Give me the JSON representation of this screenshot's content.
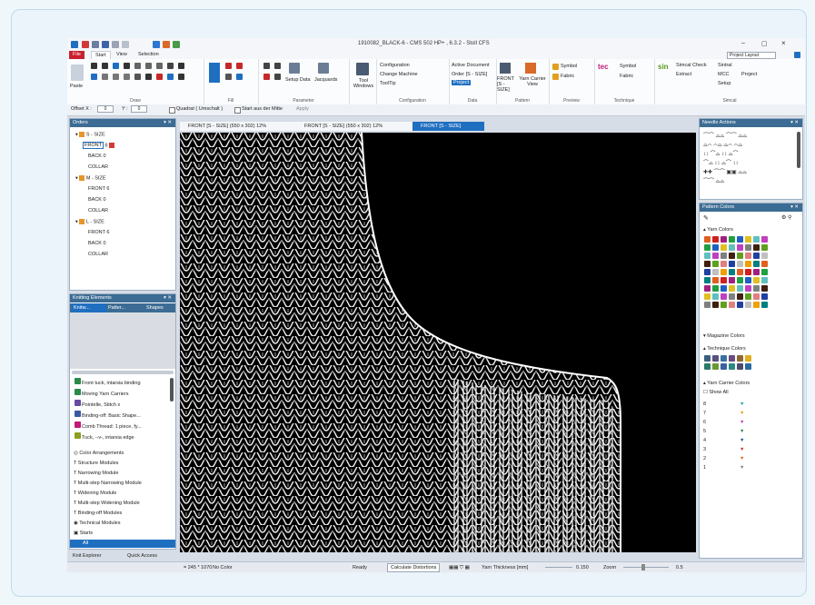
{
  "window": {
    "title": "1910082_BLACK-6 - CMS 502 HP+ , 6.3.2 - Stoll CFS",
    "project_layout": "Project Layout"
  },
  "menu": [
    "File",
    "Start",
    "View",
    "Selection"
  ],
  "ribbon": {
    "groups": [
      "Draw",
      "Fill",
      "Parameter",
      "Configuration",
      "Data",
      "Pattern",
      "Preview",
      "Technique",
      "Simcal"
    ],
    "paste": "Paste",
    "setup_data": "Setup Data",
    "jacquards": "Jacquards",
    "tool_windows": "Tool Windows",
    "configuration": "Configuration",
    "change_machine": "Change Machine",
    "tooltip": "ToolTip",
    "active_document": "Active Document",
    "order": "Order [S - SIZE]",
    "project": "Project",
    "front_size": "FRONT [S - SIZE]",
    "yarn_carrier_view": "Yarn Carrier View",
    "symbol": "Symbol",
    "fabric": "Fabric",
    "tec_symbol": "Symbol",
    "tec_fabric": "Fabric",
    "simcal_check": "Simcal Check",
    "extract": "Extract",
    "simcal": "Simcal",
    "sintral": "Sintral",
    "mcc": "MCC",
    "setup": "Setup",
    "project2": "Project"
  },
  "toolbar2": {
    "offset_x_label": "Offset X :",
    "offset_x": "0",
    "offset_y_label": "Y :",
    "offset_y": "0",
    "square": "Quadrat ( Umschalt )",
    "start_center": "Start aus der Mitte",
    "apply": "Apply"
  },
  "orders": {
    "title": "Orders",
    "items": [
      {
        "size": "S - SIZE",
        "parts": [
          "FRONT",
          "BACK",
          "COLLAR"
        ]
      },
      {
        "size": "M - SIZE",
        "parts": [
          "FRONT",
          "BACK",
          "COLLAR"
        ]
      },
      {
        "size": "L - SIZE",
        "parts": [
          "FRONT",
          "BACK",
          "COLLAR"
        ]
      }
    ],
    "count_front": "6",
    "count_back": "0"
  },
  "knitting_elements": {
    "title": "Knitting Elements",
    "tabs": [
      "Knitw...",
      "Patter...",
      "Shapes"
    ],
    "list": [
      "Front tuck, intarsia binding",
      "Moving Yarn Carriers",
      "Pointelle, Stitch x",
      "Binding-off: Basic Shape...",
      "Comb Thread: 1 piece, fy...",
      "Tuck, --v-, intarsia edge"
    ],
    "modules": [
      "Color Arrangements",
      "Structure Modules",
      "Narrowing Module",
      "Multi-step Narrowing Module",
      "Widening Module",
      "Multi-step Widening Module",
      "Binding-off Modules",
      "Technical Modules",
      "Starts"
    ],
    "all": "All"
  },
  "bottom_left": {
    "knit_explorer": "Knit Explorer",
    "quick_access": "Quick Access"
  },
  "doc_tabs": [
    "FRONT [S - SIZE] (550 x 302) 12%",
    "FRONT [S - SIZE] (550 x 302) 12%",
    "FRONT [S - SIZE]"
  ],
  "needle_actions": {
    "title": "Needle Actions"
  },
  "pattern_colors": {
    "title": "Pattern Colors",
    "sections": [
      "Yarn Colors",
      "Magazine Colors",
      "Technique Colors",
      "Yarn Carrier Colors"
    ],
    "show_all": "Show All",
    "carrier_numbers": [
      "8",
      "7",
      "6",
      "5",
      "4",
      "3",
      "2",
      "1"
    ],
    "yarn_palette": [
      "#e06020",
      "#d02020",
      "#a02080",
      "#20a040",
      "#2060c0",
      "#e0c020",
      "#60c0c0",
      "#c040c0",
      "#808080",
      "#402010",
      "#60a020",
      "#e08080",
      "#2040a0",
      "#c0c0c0",
      "#f0a000",
      "#008080"
    ]
  },
  "status": {
    "coords": "= 245 * 1070",
    "no_color": "No Color",
    "ready": "Ready",
    "calc": "Calculate Distortions",
    "thickness_label": "Yarn Thickness [mm]",
    "thickness": "0.150",
    "zoom_label": "Zoom",
    "zoom": "0.5"
  },
  "colors": {
    "accent": "#1f6fc1",
    "panel_head": "#3c6c94",
    "file_red": "#c8202f"
  }
}
